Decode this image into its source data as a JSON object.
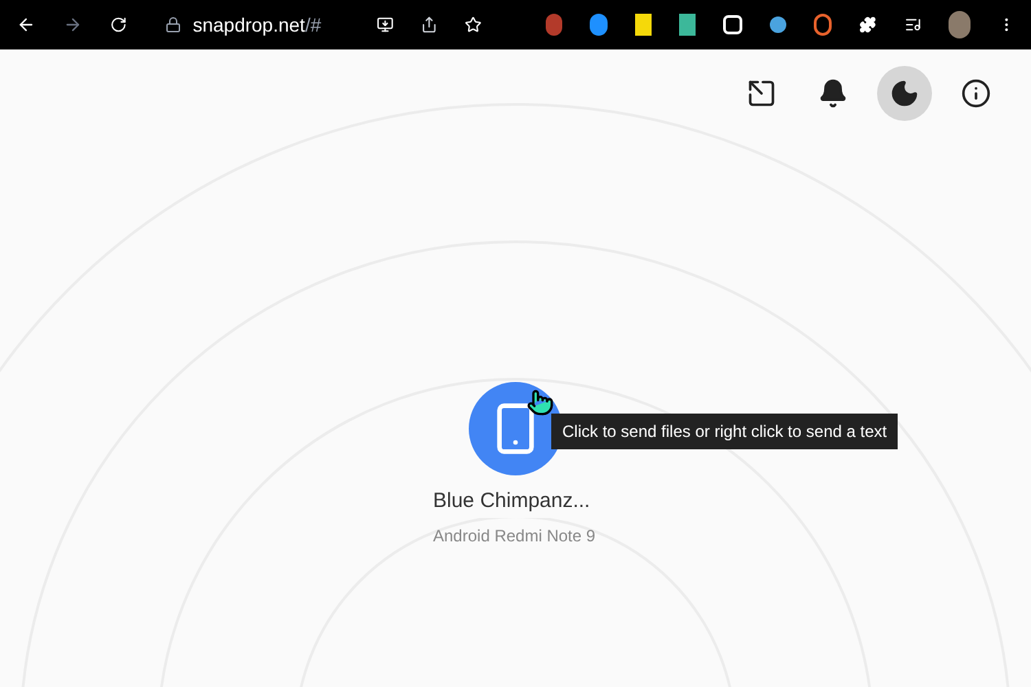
{
  "browser": {
    "url_host": "snapdrop.net",
    "url_path": "/#"
  },
  "header_buttons": [
    {
      "kind": "install",
      "active": false
    },
    {
      "kind": "notifications",
      "active": false
    },
    {
      "kind": "theme",
      "active": true
    },
    {
      "kind": "about",
      "active": false
    }
  ],
  "peer": {
    "name": "Blue Chimpanz...",
    "device": "Android Redmi Note 9",
    "tooltip": "Click to send files or right click to send a text"
  }
}
